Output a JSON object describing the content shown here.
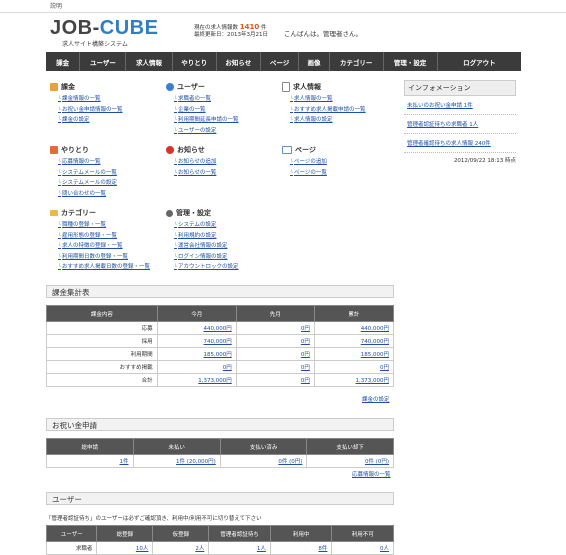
{
  "topbar": {
    "label": "説明"
  },
  "header": {
    "logo_a": "JOB-",
    "logo_b": "CUBE",
    "subtitle": "求人サイト構築システム",
    "stats_line1_pre": "現在の求人情報数",
    "stats_count": "1410",
    "stats_unit": "件",
    "stats_line2": "最終更新日：2013年3月21日",
    "greeting": "こんばんは。管理者さん。"
  },
  "nav": [
    "課金",
    "ユーザー",
    "求人情報",
    "やりとり",
    "お知らせ",
    "ページ",
    "画像",
    "カテゴリー",
    "管理・設定",
    "ログアウト"
  ],
  "sections": {
    "billing": {
      "title": "課金",
      "items": [
        "課金情報の一覧",
        "お祝い金申請情報の一覧",
        "課金の設定"
      ]
    },
    "user": {
      "title": "ユーザー",
      "items": [
        "求職者の一覧",
        "企業の一覧",
        "利用期間延長申請の一覧",
        "ユーザーの設定"
      ]
    },
    "job": {
      "title": "求人情報",
      "items": [
        "求人情報の一覧",
        "おすすめ求人掲載申請の一覧",
        "求人情報の設定"
      ]
    },
    "exchange": {
      "title": "やりとり",
      "items": [
        "応募情報の一覧",
        "システムメールの一覧",
        "システムメールの設定",
        "問い合わせの一覧"
      ]
    },
    "notice": {
      "title": "お知らせ",
      "items": [
        "お知らせの追加",
        "お知らせの一覧"
      ]
    },
    "page": {
      "title": "ページ",
      "items": [
        "ページの追加",
        "ページの一覧"
      ]
    },
    "category": {
      "title": "カテゴリー",
      "items": [
        "職種の登録・一覧",
        "雇用形態の登録・一覧",
        "求人の特徴の登録・一覧",
        "利用期間日数の登録・一覧",
        "おすすめ求人掲載日数の登録・一覧"
      ]
    },
    "admin": {
      "title": "管理・設定",
      "items": [
        "システムの設定",
        "利用規約の設定",
        "運営会社情報の設定",
        "ログイン情報の設定",
        "アカウントロックの設定"
      ]
    }
  },
  "info": {
    "title": "インフォメーション",
    "items": [
      "未払いのお祝い金申請 1件",
      "管理者認証待ちの求職者 1人",
      "管理者確認待ちの求人情報 240件"
    ],
    "date": "2012/09/22 18:13 時点"
  },
  "billing_summary": {
    "title": "課金集計表",
    "headers": [
      "課金内容",
      "今月",
      "先月",
      "累計"
    ],
    "rows": [
      [
        "応募",
        "440,000円",
        "0円",
        "440,000円"
      ],
      [
        "採用",
        "740,000円",
        "0円",
        "740,000円"
      ],
      [
        "利用期間",
        "185,000円",
        "0円",
        "185,000円"
      ],
      [
        "おすすめ掲載",
        "0円",
        "0円",
        "0円"
      ],
      [
        "合計",
        "1,373,000円",
        "0円",
        "1,373,000円"
      ]
    ],
    "link": "課金の設定"
  },
  "celebration": {
    "title": "お祝い金申請",
    "headers": [
      "総申請",
      "未払い",
      "支払い済み",
      "支払い却下"
    ],
    "row": [
      "1件",
      "1件 (20,000円)",
      "0件 (0円)",
      "0件 (0円)"
    ],
    "link": "応募情報の一覧"
  },
  "users": {
    "title": "ユーザー",
    "notice": "「管理者認証待ち」のユーザーは必ずご確認頂き、利用中/利用不可に切り替えて下さい",
    "headers": [
      "ユーザー",
      "総登録",
      "仮登録",
      "管理者認証待ち",
      "利用中",
      "利用不可"
    ],
    "row": [
      "求職者",
      "10人",
      "2人",
      "1人",
      "8件",
      "0人"
    ]
  }
}
